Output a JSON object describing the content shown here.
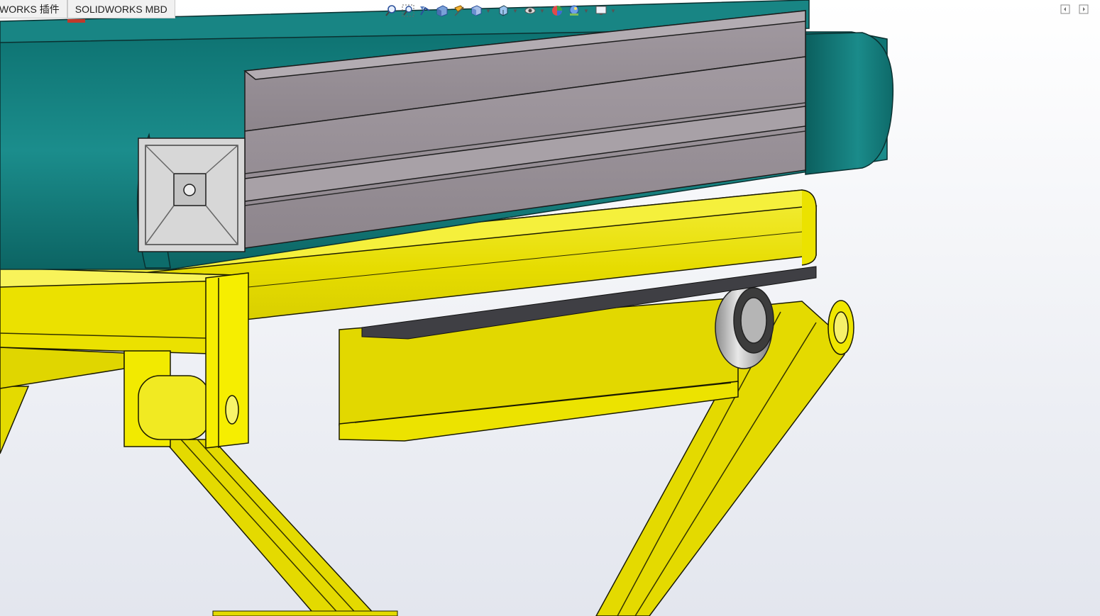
{
  "command_tabs": [
    {
      "label": "WORKS 插件"
    },
    {
      "label": "SOLIDWORKS MBD"
    }
  ],
  "heads_up_toolbar": [
    {
      "icon": "zoom-to-fit-icon",
      "dropdown": false
    },
    {
      "icon": "zoom-to-area-icon",
      "dropdown": false
    },
    {
      "icon": "previous-view-icon",
      "dropdown": false
    },
    {
      "icon": "section-view-icon",
      "dropdown": false
    },
    {
      "icon": "dynamic-annotation-views-icon",
      "dropdown": false
    },
    {
      "icon": "view-orientation-icon",
      "dropdown": true
    },
    {
      "icon": "display-style-icon",
      "dropdown": true
    },
    {
      "icon": "hide-show-items-icon",
      "dropdown": true
    },
    {
      "icon": "edit-appearance-icon",
      "dropdown": false
    },
    {
      "icon": "apply-scene-icon",
      "dropdown": true
    },
    {
      "icon": "view-settings-icon",
      "dropdown": true
    }
  ],
  "window_controls": [
    {
      "icon": "tile-left-icon"
    },
    {
      "icon": "tile-right-icon"
    }
  ],
  "colors": {
    "frame_yellow": "#e8df00",
    "belt_teal": "#137f7e",
    "aluminum_profile": "#9a9198",
    "background_gradient_top": "#ffffff",
    "background_gradient_bottom": "#e2e6ee"
  }
}
